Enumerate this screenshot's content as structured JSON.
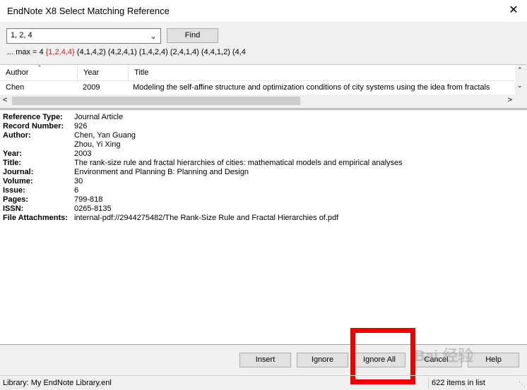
{
  "window": {
    "title": "EndNote X8 Select Matching Reference",
    "close_glyph": "✕"
  },
  "search": {
    "value": "1, 2, 4",
    "find_label": "Find"
  },
  "combinations": {
    "prefix": "...  max = 4",
    "highlighted": "{1,2,4,4}",
    "rest": "(4,1,4,2)  (4,2,4,1)  (1,4,2,4)  (2,4,1,4)  (4,4,1,2)  (4,4"
  },
  "list": {
    "columns": [
      "Author",
      "Year",
      "Title"
    ],
    "rows": [
      {
        "author": "Chen",
        "year": "2009",
        "title": "Modeling the self-affine structure and optimization conditions of city systems using the idea from fractals"
      }
    ]
  },
  "reference": {
    "fields": [
      {
        "label": "Reference Type:",
        "value": "Journal Article"
      },
      {
        "label": "Record Number:",
        "value": "926"
      },
      {
        "label": "Author:",
        "value": "Chen, Yan Guang"
      },
      {
        "label": "",
        "value": "Zhou, Yi Xing"
      },
      {
        "label": "Year:",
        "value": "2003"
      },
      {
        "label": "Title:",
        "value": "The rank-size rule and fractal hierarchies of cities: mathematical models and empirical analyses"
      },
      {
        "label": "Journal:",
        "value": "Environment and Planning B: Planning and Design"
      },
      {
        "label": "Volume:",
        "value": "30"
      },
      {
        "label": "Issue:",
        "value": "6"
      },
      {
        "label": "Pages:",
        "value": "799-818"
      },
      {
        "label": "ISSN:",
        "value": "0265-8135"
      },
      {
        "label": "File Attachments:",
        "value": "internal-pdf://2944275482/The Rank-Size Rule and Fractal Hierarchies of.pdf"
      }
    ]
  },
  "buttons": {
    "insert": "Insert",
    "ignore": "Ignore",
    "ignore_all": "Ignore All",
    "cancel": "Cancel",
    "help": "Help"
  },
  "status": {
    "library": "Library: My EndNote Library.enl",
    "count": "622 items in list"
  },
  "watermark": "Bai 经验",
  "colors": {
    "highlight": "#d42020",
    "annotation_box": "#ee0000"
  }
}
